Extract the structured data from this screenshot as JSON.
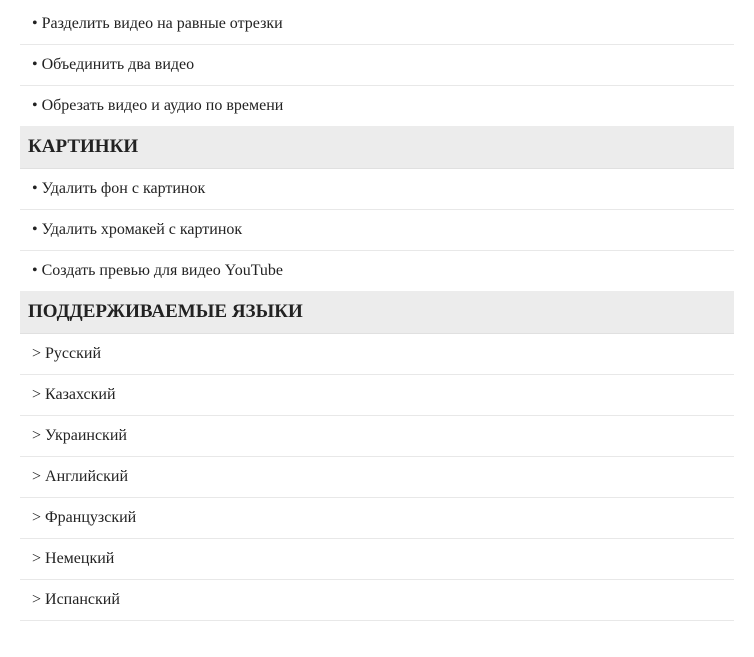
{
  "video_section": {
    "items": [
      "• Разделить видео на равные отрезки",
      "• Объединить два видео",
      "• Обрезать видео и аудио по времени"
    ]
  },
  "images_section": {
    "header": "КАРТИНКИ",
    "items": [
      "• Удалить фон с картинок",
      "• Удалить хромакей с картинок",
      "• Создать превью для видео YouTube"
    ]
  },
  "languages_section": {
    "header": "ПОДДЕРЖИВАЕМЫЕ ЯЗЫКИ",
    "items": [
      "> Русский",
      "> Казахский",
      "> Украинский",
      "> Английский",
      "> Французский",
      "> Немецкий",
      "> Испанский"
    ]
  }
}
